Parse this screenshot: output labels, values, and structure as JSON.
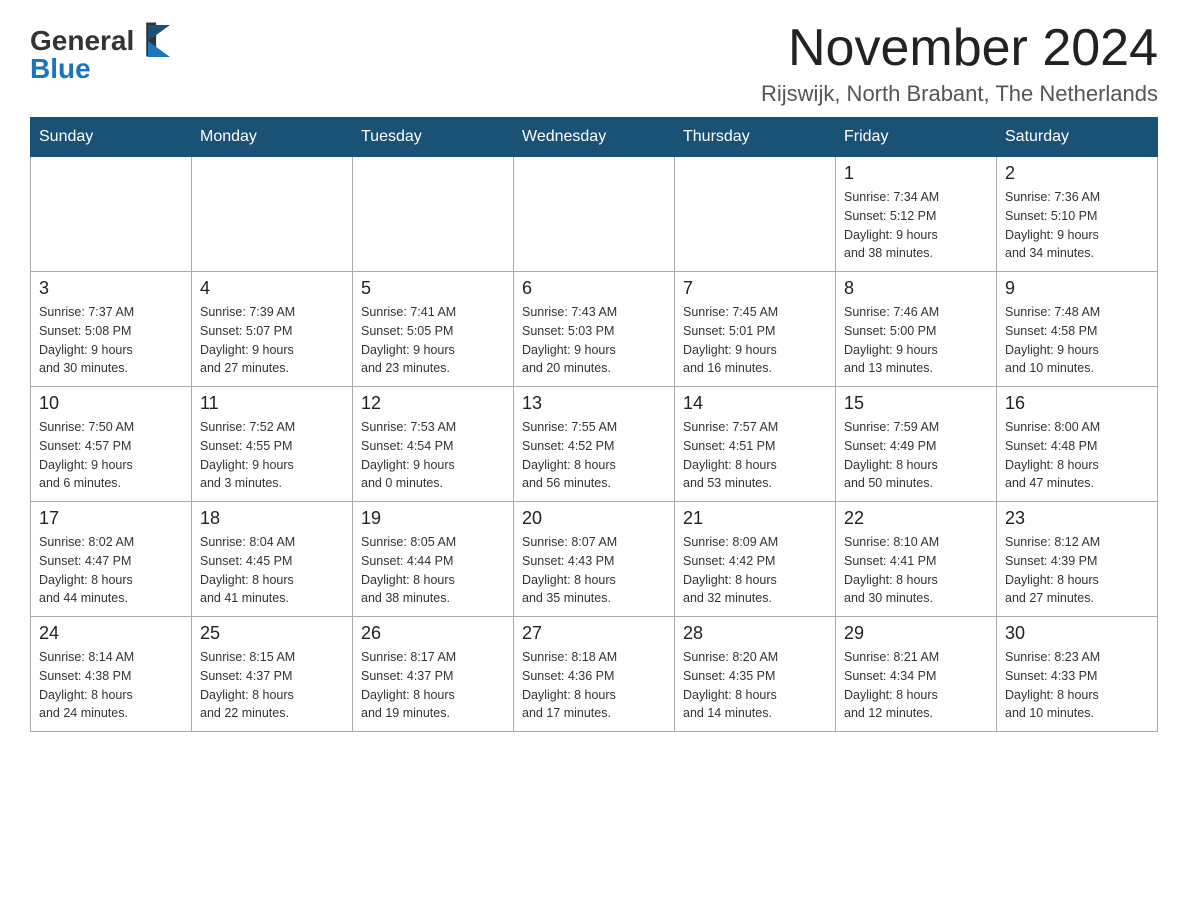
{
  "logo": {
    "general": "General",
    "blue": "Blue"
  },
  "title": {
    "month": "November 2024",
    "location": "Rijswijk, North Brabant, The Netherlands"
  },
  "weekdays": [
    "Sunday",
    "Monday",
    "Tuesday",
    "Wednesday",
    "Thursday",
    "Friday",
    "Saturday"
  ],
  "weeks": [
    [
      {
        "day": "",
        "info": ""
      },
      {
        "day": "",
        "info": ""
      },
      {
        "day": "",
        "info": ""
      },
      {
        "day": "",
        "info": ""
      },
      {
        "day": "",
        "info": ""
      },
      {
        "day": "1",
        "info": "Sunrise: 7:34 AM\nSunset: 5:12 PM\nDaylight: 9 hours\nand 38 minutes."
      },
      {
        "day": "2",
        "info": "Sunrise: 7:36 AM\nSunset: 5:10 PM\nDaylight: 9 hours\nand 34 minutes."
      }
    ],
    [
      {
        "day": "3",
        "info": "Sunrise: 7:37 AM\nSunset: 5:08 PM\nDaylight: 9 hours\nand 30 minutes."
      },
      {
        "day": "4",
        "info": "Sunrise: 7:39 AM\nSunset: 5:07 PM\nDaylight: 9 hours\nand 27 minutes."
      },
      {
        "day": "5",
        "info": "Sunrise: 7:41 AM\nSunset: 5:05 PM\nDaylight: 9 hours\nand 23 minutes."
      },
      {
        "day": "6",
        "info": "Sunrise: 7:43 AM\nSunset: 5:03 PM\nDaylight: 9 hours\nand 20 minutes."
      },
      {
        "day": "7",
        "info": "Sunrise: 7:45 AM\nSunset: 5:01 PM\nDaylight: 9 hours\nand 16 minutes."
      },
      {
        "day": "8",
        "info": "Sunrise: 7:46 AM\nSunset: 5:00 PM\nDaylight: 9 hours\nand 13 minutes."
      },
      {
        "day": "9",
        "info": "Sunrise: 7:48 AM\nSunset: 4:58 PM\nDaylight: 9 hours\nand 10 minutes."
      }
    ],
    [
      {
        "day": "10",
        "info": "Sunrise: 7:50 AM\nSunset: 4:57 PM\nDaylight: 9 hours\nand 6 minutes."
      },
      {
        "day": "11",
        "info": "Sunrise: 7:52 AM\nSunset: 4:55 PM\nDaylight: 9 hours\nand 3 minutes."
      },
      {
        "day": "12",
        "info": "Sunrise: 7:53 AM\nSunset: 4:54 PM\nDaylight: 9 hours\nand 0 minutes."
      },
      {
        "day": "13",
        "info": "Sunrise: 7:55 AM\nSunset: 4:52 PM\nDaylight: 8 hours\nand 56 minutes."
      },
      {
        "day": "14",
        "info": "Sunrise: 7:57 AM\nSunset: 4:51 PM\nDaylight: 8 hours\nand 53 minutes."
      },
      {
        "day": "15",
        "info": "Sunrise: 7:59 AM\nSunset: 4:49 PM\nDaylight: 8 hours\nand 50 minutes."
      },
      {
        "day": "16",
        "info": "Sunrise: 8:00 AM\nSunset: 4:48 PM\nDaylight: 8 hours\nand 47 minutes."
      }
    ],
    [
      {
        "day": "17",
        "info": "Sunrise: 8:02 AM\nSunset: 4:47 PM\nDaylight: 8 hours\nand 44 minutes."
      },
      {
        "day": "18",
        "info": "Sunrise: 8:04 AM\nSunset: 4:45 PM\nDaylight: 8 hours\nand 41 minutes."
      },
      {
        "day": "19",
        "info": "Sunrise: 8:05 AM\nSunset: 4:44 PM\nDaylight: 8 hours\nand 38 minutes."
      },
      {
        "day": "20",
        "info": "Sunrise: 8:07 AM\nSunset: 4:43 PM\nDaylight: 8 hours\nand 35 minutes."
      },
      {
        "day": "21",
        "info": "Sunrise: 8:09 AM\nSunset: 4:42 PM\nDaylight: 8 hours\nand 32 minutes."
      },
      {
        "day": "22",
        "info": "Sunrise: 8:10 AM\nSunset: 4:41 PM\nDaylight: 8 hours\nand 30 minutes."
      },
      {
        "day": "23",
        "info": "Sunrise: 8:12 AM\nSunset: 4:39 PM\nDaylight: 8 hours\nand 27 minutes."
      }
    ],
    [
      {
        "day": "24",
        "info": "Sunrise: 8:14 AM\nSunset: 4:38 PM\nDaylight: 8 hours\nand 24 minutes."
      },
      {
        "day": "25",
        "info": "Sunrise: 8:15 AM\nSunset: 4:37 PM\nDaylight: 8 hours\nand 22 minutes."
      },
      {
        "day": "26",
        "info": "Sunrise: 8:17 AM\nSunset: 4:37 PM\nDaylight: 8 hours\nand 19 minutes."
      },
      {
        "day": "27",
        "info": "Sunrise: 8:18 AM\nSunset: 4:36 PM\nDaylight: 8 hours\nand 17 minutes."
      },
      {
        "day": "28",
        "info": "Sunrise: 8:20 AM\nSunset: 4:35 PM\nDaylight: 8 hours\nand 14 minutes."
      },
      {
        "day": "29",
        "info": "Sunrise: 8:21 AM\nSunset: 4:34 PM\nDaylight: 8 hours\nand 12 minutes."
      },
      {
        "day": "30",
        "info": "Sunrise: 8:23 AM\nSunset: 4:33 PM\nDaylight: 8 hours\nand 10 minutes."
      }
    ]
  ]
}
